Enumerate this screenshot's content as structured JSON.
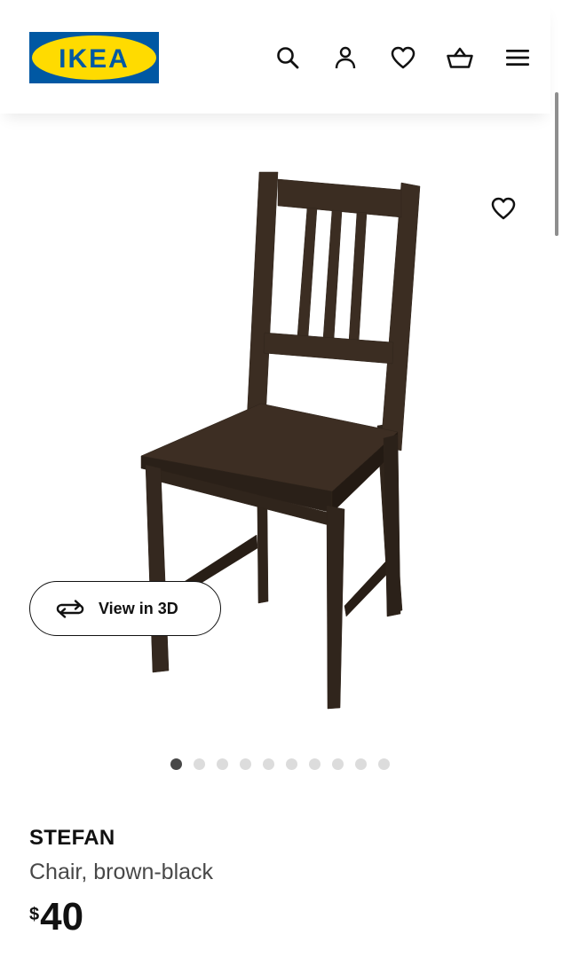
{
  "header": {
    "logo_text": "IKEA",
    "icons": [
      "search-icon",
      "profile-icon",
      "heart-icon",
      "basket-icon",
      "menu-icon"
    ]
  },
  "gallery": {
    "view_3d_label": "View in 3D",
    "image_count": 10,
    "active_image_index": 0
  },
  "product": {
    "name": "STEFAN",
    "description": "Chair, brown-black",
    "price_currency": "$",
    "price_amount": "40"
  },
  "colors": {
    "ikea_blue": "#0058a3",
    "ikea_yellow": "#ffdb00",
    "text": "#111111",
    "secondary_text": "#484848",
    "chair_wood": "#3b2d22"
  }
}
